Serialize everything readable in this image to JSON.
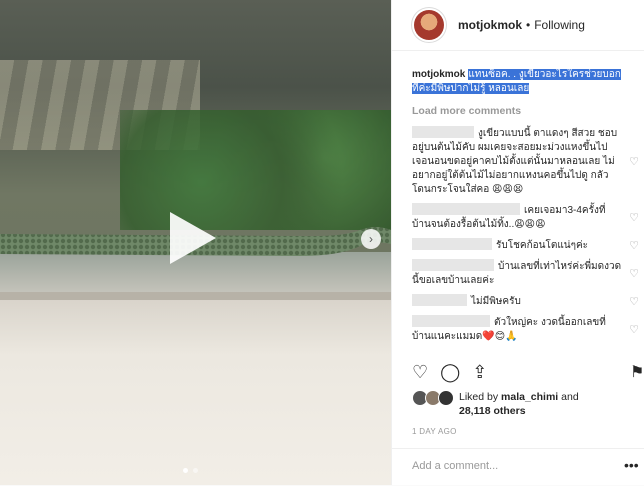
{
  "media": {
    "play_icon": "play-icon",
    "next_icon": "chevron-right-icon",
    "carousel_dots": 2
  },
  "header": {
    "username": "motjokmok",
    "separator": "•",
    "follow_label": "Following"
  },
  "caption": {
    "username": "motjokmok",
    "text": "แทนซ็อค. . งูเขียวอะไรใครช่วยบอกทีค่ะมีพิษปากไม่รู้ หลอนเลย"
  },
  "load_more": "Load more comments",
  "comments": [
    {
      "text": "งูเขียวแบบนี้ ตาแดงๆ สีสวย ชอบอยู่บนต้นไม้คับ ผมเคยจะสอยมะม่วงแหงขึ้นไปเจอนอนขดอยู่คาคบไม้ตั้งแต่นั้นมาหลอนเลย ไม่อยากอยู่ใต้ต้นไม้ไม่อยากแหงนคอขึ้นไปดู กลัวโดนกระโจนใส่คอ 😩😩😫"
    },
    {
      "text": "เคยเจอมา3-4ครั้งที่บ้านจนต้องรื้อต้นไม้ทิ้ง..😩😩😩"
    },
    {
      "text": "รับโชคก้อนโตแน่ๆค่ะ"
    },
    {
      "text": "บ้านเลขที่เท่าไหร่ค่ะพี่มดงวดนี้ขอเลขบ้านเลยค่ะ"
    },
    {
      "text": "ไม่มีพิษครับ"
    },
    {
      "text": "ตัวใหญ่คะ งวดนี้ออกเลขที่บ้านแนคะแมมด❤️😊🙏"
    }
  ],
  "actions": {
    "like_icon": "heart-icon",
    "comment_icon": "comment-icon",
    "share_icon": "share-icon",
    "bookmark_icon": "bookmark-icon"
  },
  "likes": {
    "prefix": "Liked by",
    "user": "mala_chimi",
    "middle": "and",
    "count": "28,118 others"
  },
  "time": "1 DAY AGO",
  "add_comment_placeholder": "Add a comment...",
  "more_glyph": "•••",
  "colors": {
    "highlight": "#3a73d8",
    "muted": "#999999",
    "text": "#262626"
  }
}
